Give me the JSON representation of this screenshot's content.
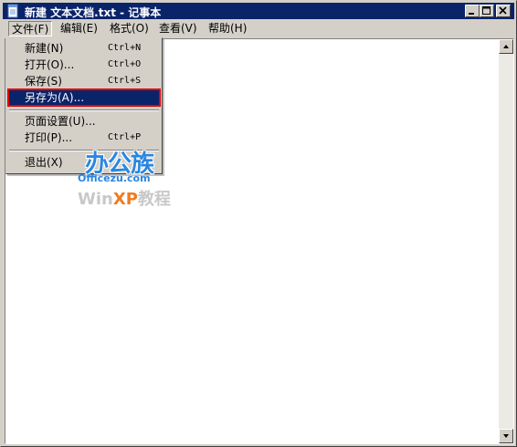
{
  "window": {
    "title": "新建 文本文档.txt - 记事本",
    "accent_color": "#0a246a",
    "icon": "notepad-icon",
    "controls": [
      "minimize-icon",
      "maximize-icon",
      "close-icon"
    ]
  },
  "menubar": {
    "items": [
      {
        "label": "文件(F)"
      },
      {
        "label": "编辑(E)"
      },
      {
        "label": "格式(O)"
      },
      {
        "label": "查看(V)"
      },
      {
        "label": "帮助(H)"
      }
    ]
  },
  "file_menu": {
    "items": [
      {
        "label": "新建(N)",
        "shortcut": "Ctrl+N"
      },
      {
        "label": "打开(O)...",
        "shortcut": "Ctrl+O"
      },
      {
        "label": "保存(S)",
        "shortcut": "Ctrl+S"
      },
      {
        "label": "另存为(A)...",
        "shortcut": ""
      },
      {
        "label": "页面设置(U)...",
        "shortcut": ""
      },
      {
        "label": "打印(P)...",
        "shortcut": "Ctrl+P"
      },
      {
        "label": "退出(X)",
        "shortcut": ""
      }
    ],
    "highlight_color": "#e00000"
  },
  "watermark": {
    "logo": "办公族",
    "domain": "Officezu.com",
    "win": "Win",
    "xp": "XP",
    "tutorial": "教程"
  }
}
